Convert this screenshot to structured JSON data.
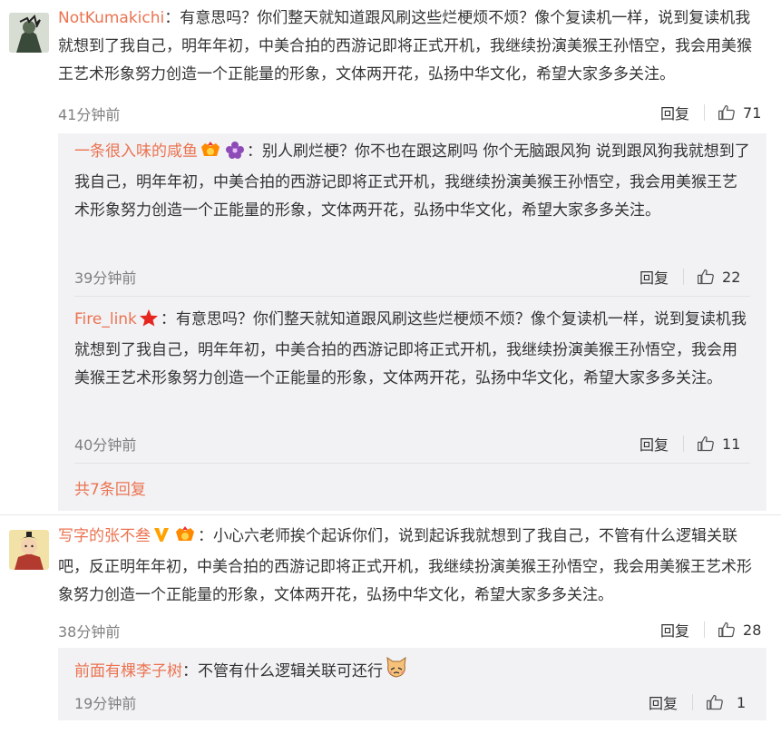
{
  "comments": [
    {
      "username": "NotKumakichi",
      "text": "：有意思吗？你们整天就知道跟风刷这些烂梗烦不烦？像个复读机一样，说到复读机我就想到了我自己，明年年初，中美合拍的西游记即将正式开机，我继续扮演美猴王孙悟空，我会用美猴王艺术形象努力创造一个正能量的形象，文体两开花，弘扬中华文化，希望大家多多关注。",
      "time": "41分钟前",
      "reply_label": "回复",
      "likes": "71",
      "replies": [
        {
          "username": "一条很入味的咸鱼",
          "text": "：别人刷烂梗？你不也在跟这刷吗 你个无脑跟风狗 说到跟风狗我就想到了我自己，明年年初，中美合拍的西游记即将正式开机，我继续扮演美猴王孙悟空，我会用美猴王艺术形象努力创造一个正能量的形象，文体两开花，弘扬中华文化，希望大家多多关注。",
          "time": "39分钟前",
          "reply_label": "回复",
          "likes": "22"
        },
        {
          "username": "Fire_link",
          "text": "：有意思吗？你们整天就知道跟风刷这些烂梗烦不烦？像个复读机一样，说到复读机我就想到了我自己，明年年初，中美合拍的西游记即将正式开机，我继续扮演美猴王孙悟空，我会用美猴王艺术形象努力创造一个正能量的形象，文体两开花，弘扬中华文化，希望大家多多关注。",
          "time": "40分钟前",
          "reply_label": "回复",
          "likes": "11"
        }
      ],
      "more_replies": "共7条回复"
    },
    {
      "username": "写字的张不叁",
      "text": "：小心六老师挨个起诉你们，说到起诉我就想到了我自己，不管有什么逻辑关联吧，反正明年年初，中美合拍的西游记即将正式开机，我继续扮演美猴王孙悟空，我会用美猴王艺术形象努力创造一个正能量的形象，文体两开花，弘扬中华文化，希望大家多多关注。",
      "time": "38分钟前",
      "reply_label": "回复",
      "likes": "28",
      "replies": [
        {
          "username": "前面有棵李子树",
          "text": "：不管有什么逻辑关联可还行",
          "time": "19分钟前",
          "reply_label": "回复",
          "likes": "1"
        }
      ]
    }
  ],
  "icons": {
    "like": "thumbs-up-icon",
    "star": "red-star-icon",
    "vip": "vip-badge-icon",
    "flower": "purple-flower-icon",
    "verified": "orange-v-icon",
    "cat": "cat-emoji-icon"
  },
  "colors": {
    "username": "#eb7350",
    "text": "#333333",
    "meta": "#808080",
    "reply_bg": "#f2f2f5"
  }
}
